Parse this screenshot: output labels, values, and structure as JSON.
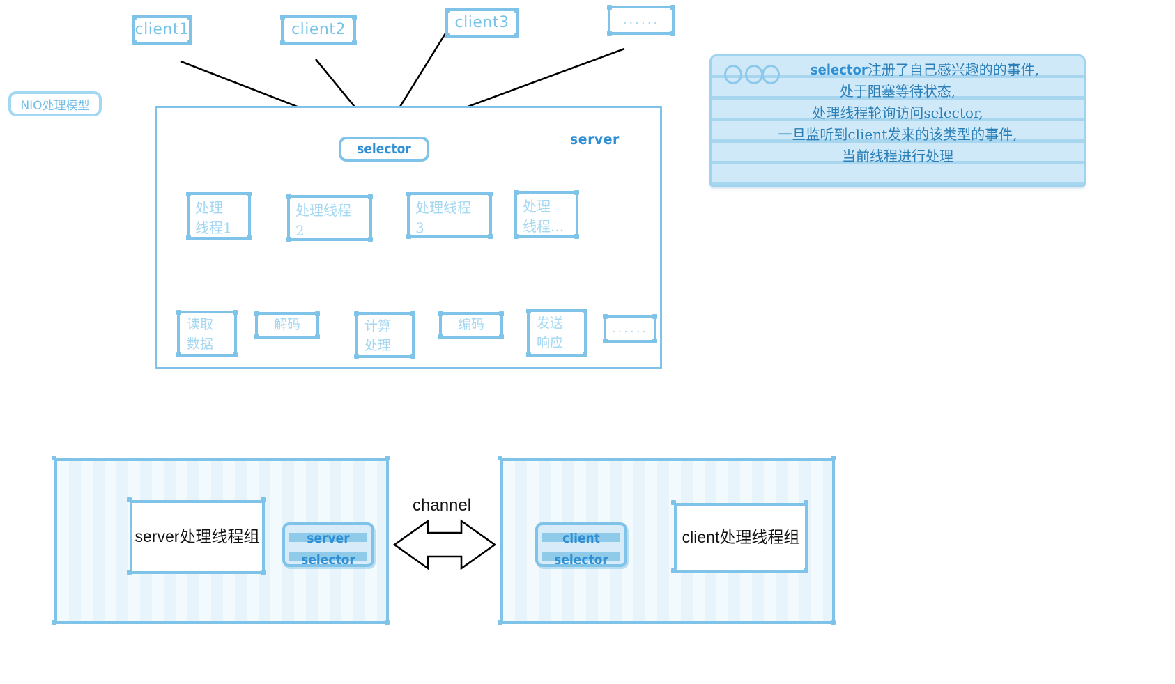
{
  "diagram": {
    "title_tag": "NIO处理模型",
    "clients": [
      {
        "label": "client1"
      },
      {
        "label": "client2"
      },
      {
        "label": "client3"
      },
      {
        "label": "......"
      }
    ],
    "server": {
      "label": "server",
      "selector": "selector",
      "threads": [
        {
          "label": "处理\n线程1"
        },
        {
          "label": "处理线程\n2"
        },
        {
          "label": "处理线程\n3"
        },
        {
          "label": "处理\n线程..."
        }
      ],
      "stages": [
        {
          "label": "读取\n数据"
        },
        {
          "label": "解码"
        },
        {
          "label": "计算\n处理"
        },
        {
          "label": "编码"
        },
        {
          "label": "发送\n响应"
        },
        {
          "label": "......"
        }
      ]
    },
    "note": {
      "text": "selector注册了自己感兴趣的的事件,\n处于阻塞等待状态,\n处理线程轮询访问selector,\n一旦监听到client发来的该类型的事件,\n当前线程进行处理",
      "highlight_word": "selector"
    },
    "bottom": {
      "left_group": "server处理线程组",
      "left_selector_line1": "server",
      "left_selector_line2": "selector",
      "channel": "channel",
      "right_selector_line1": "client",
      "right_selector_line2": "selector",
      "right_group": "client处理线程组"
    }
  },
  "colors": {
    "sketch_blue": "#7fc4e8",
    "pale_blue": "#a3d7f2",
    "accent_blue": "#2f8fd4",
    "note_bg": "#cfe9f8",
    "note_rule": "#a8d6ef",
    "arrow_black": "#000000"
  }
}
